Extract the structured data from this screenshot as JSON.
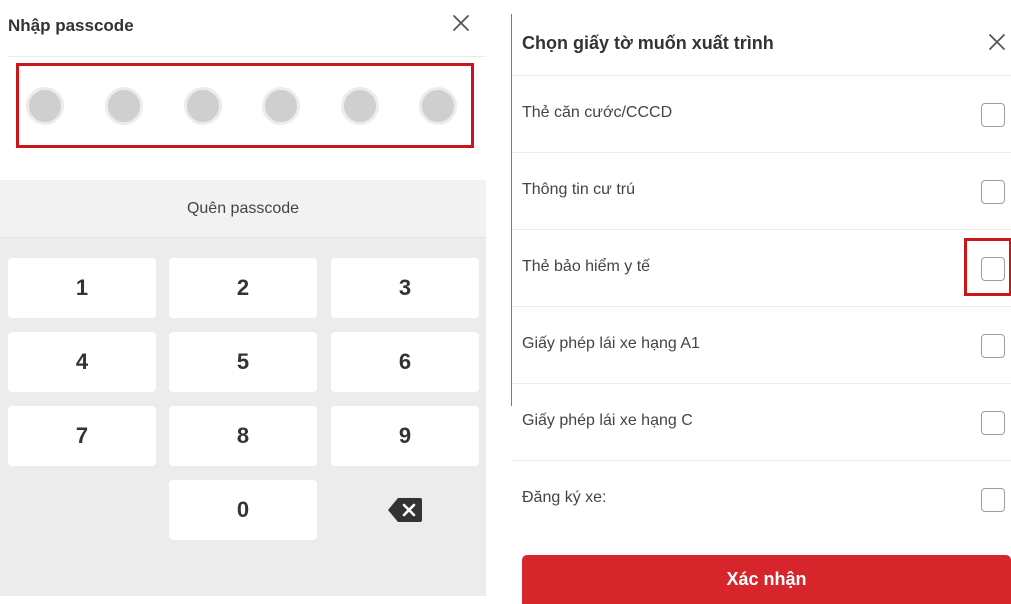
{
  "passcode": {
    "title": "Nhập passcode",
    "close_icon": "close-icon",
    "digit_count": 6,
    "entered_count": 0,
    "forgot_label": "Quên passcode",
    "keys": [
      "1",
      "2",
      "3",
      "4",
      "5",
      "6",
      "7",
      "8",
      "9",
      "",
      "0",
      "backspace"
    ],
    "backspace_icon": "backspace-icon",
    "highlight_color": "#c9151b"
  },
  "documents": {
    "title": "Chọn giấy tờ muốn xuất trình",
    "close_icon": "close-icon",
    "items": [
      {
        "label": "Thẻ căn cước/CCCD",
        "checked": false
      },
      {
        "label": "Thông tin cư trú",
        "checked": false
      },
      {
        "label": "Thẻ bảo hiểm y tế",
        "checked": false,
        "highlighted": true
      },
      {
        "label": "Giấy phép lái xe hạng A1",
        "checked": false
      },
      {
        "label": "Giấy phép lái xe hạng C",
        "checked": false
      },
      {
        "label": "Đăng ký xe:",
        "checked": false
      }
    ],
    "confirm_label": "Xác nhận",
    "accent_color": "#d7262b"
  }
}
